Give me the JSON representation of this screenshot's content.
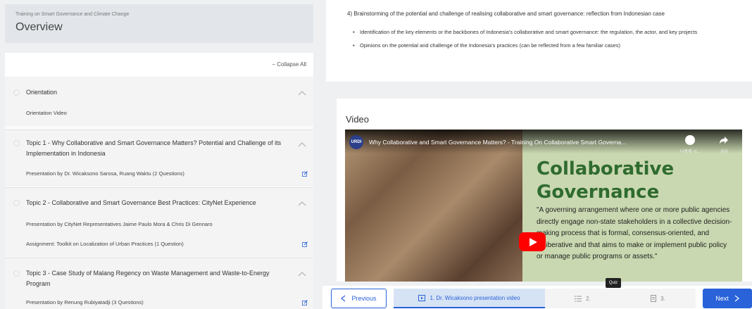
{
  "course": {
    "subtitle": "Training on Smart Governance and Climate Change",
    "title": "Overview",
    "collapse_label": "− Collapse All"
  },
  "topics": [
    {
      "title": "Orientation",
      "items": [
        "Orientation Video"
      ]
    },
    {
      "title": "Topic 1 - Why Collaborative and Smart Governance Matters? Potential and Challenge of its Implementation in Indonesia",
      "items": [
        "Presentation by Dr. Wicaksono Sarosa, Ruang Waktu (2 Questions)"
      ]
    },
    {
      "title": "Topic 2 - Collaborative and Smart Governance Best Practices: CityNet Experience",
      "items": [
        "Presentation by CityNet Representatives Jaime Paulo Mora & Chris Di Gennaro",
        "Assignment: Toolkit on Localization of Urban Practices (1 Question)"
      ]
    },
    {
      "title": "Topic 3 - Case Study of Malang Regency on Waste Management and Waste-to-Energy Program",
      "items": [
        "Presentation by Renung Rubiyatadji (3 Questions)"
      ]
    }
  ],
  "content": {
    "brainstorm": "4) Brainstorming of the potential and challenge of realising collaborative and smart governance: reflection from Indonesian case",
    "bullets": [
      "Identification of the key elements or the backbones of Indonesia's collaborative and smart governance: the regulation, the actor, and key projects",
      "Opinions on the potential and challenge of the Indonesia's practices (can be reflected from a few familiar cases)"
    ]
  },
  "video": {
    "heading": "Video",
    "channel": "URDI",
    "title": "Why Collaborative and Smart Governance Matters? - Training On Collaborative Smart Governa...",
    "watch_later": "나중에 시...",
    "share": "공유",
    "slide_title_1": "Collaborative",
    "slide_title_2": "Governance",
    "slide_quote": "\"A governing arrangement where one or more public agencies directly engage non-state stakeholders in a collective decision-making process that is formal, consensus-oriented, and deliberative and that aims to make or implement public policy or manage public programs or assets.\""
  },
  "nav": {
    "previous": "Previous",
    "next": "Next",
    "step1": "1. Dr. Wicaksono presentation video",
    "step2": "2.",
    "step3": "3.",
    "tooltip": "Quiz"
  },
  "colors": {
    "accent": "#2962d9",
    "youtube_red": "#ff0000"
  }
}
